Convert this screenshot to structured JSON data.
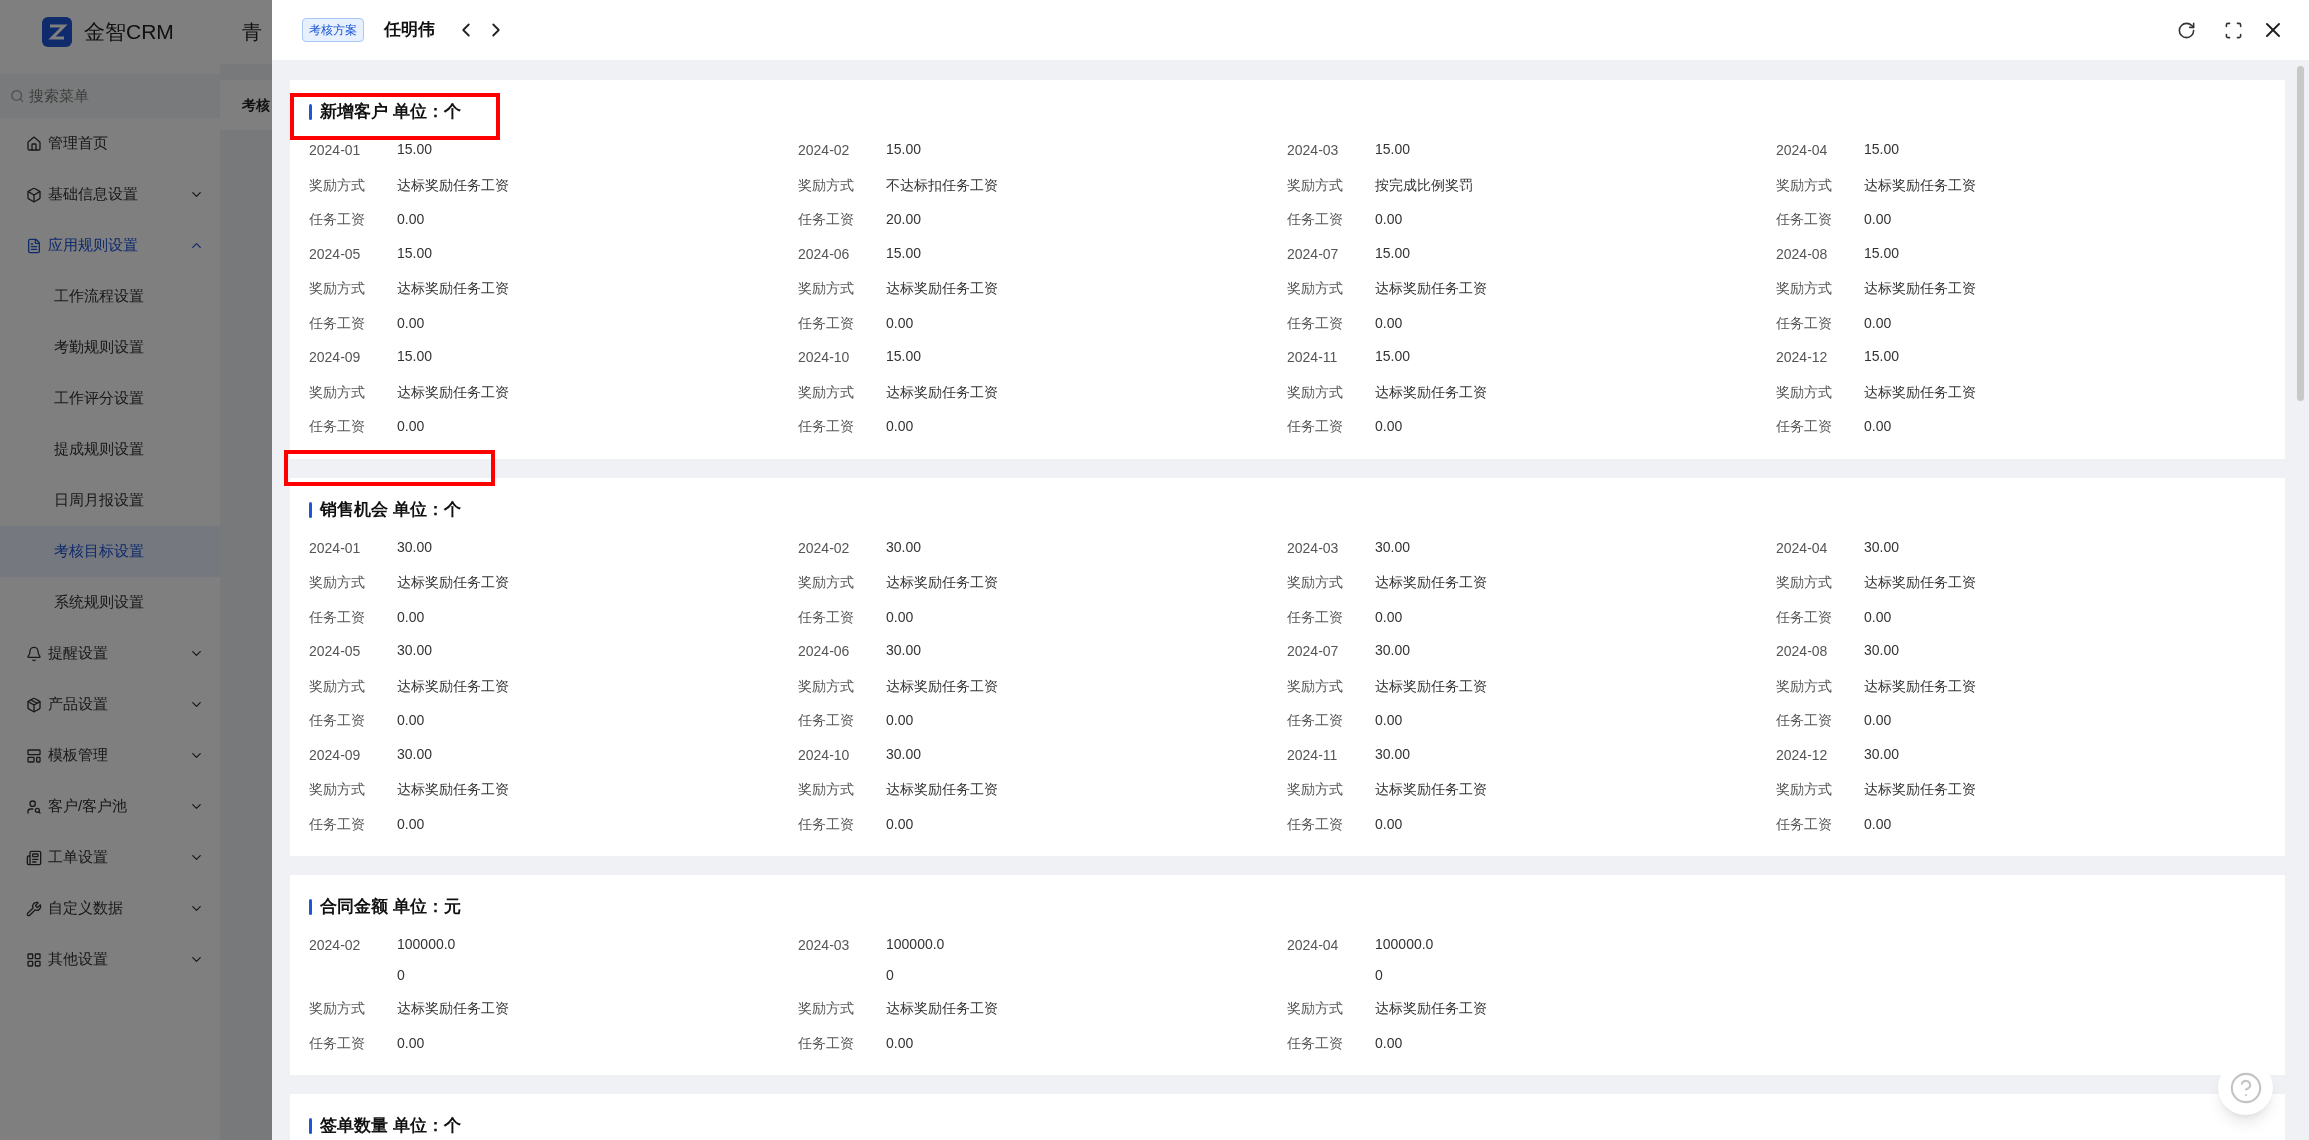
{
  "app": {
    "logo_text": "金智CRM",
    "header_fragment": "青",
    "page_title_fragment": "考核",
    "search": {
      "placeholder": "搜索菜单"
    }
  },
  "sidebar": {
    "items": [
      {
        "label": "管理首页",
        "kind": "link",
        "selected": false
      },
      {
        "label": "基础信息设置",
        "kind": "group",
        "expanded": false,
        "selected": false
      },
      {
        "label": "应用规则设置",
        "kind": "group",
        "expanded": true,
        "selected": true,
        "children": [
          {
            "label": "工作流程设置",
            "selected": false
          },
          {
            "label": "考勤规则设置",
            "selected": false
          },
          {
            "label": "工作评分设置",
            "selected": false
          },
          {
            "label": "提成规则设置",
            "selected": false
          },
          {
            "label": "日周月报设置",
            "selected": false
          },
          {
            "label": "考核目标设置",
            "selected": true
          },
          {
            "label": "系统规则设置",
            "selected": false
          }
        ]
      },
      {
        "label": "提醒设置",
        "kind": "group",
        "expanded": false,
        "selected": false
      },
      {
        "label": "产品设置",
        "kind": "group",
        "expanded": false,
        "selected": false
      },
      {
        "label": "模板管理",
        "kind": "group",
        "expanded": false,
        "selected": false
      },
      {
        "label": "客户/客户池",
        "kind": "group",
        "expanded": false,
        "selected": false
      },
      {
        "label": "工单设置",
        "kind": "group",
        "expanded": false,
        "selected": false
      },
      {
        "label": "自定义数据",
        "kind": "group",
        "expanded": false,
        "selected": false
      },
      {
        "label": "其他设置",
        "kind": "group",
        "expanded": false,
        "selected": false
      }
    ]
  },
  "drawer": {
    "tag": "考核方案",
    "person": "任明伟",
    "sections": [
      {
        "title": "新增客户 单位：个",
        "highlighted": true,
        "items": [
          {
            "month": "2024-01",
            "target": "15.00",
            "reward_label": "奖励方式",
            "reward": "达标奖励任务工资",
            "wage_label": "任务工资",
            "wage": "0.00"
          },
          {
            "month": "2024-02",
            "target": "15.00",
            "reward_label": "奖励方式",
            "reward": "不达标扣任务工资",
            "wage_label": "任务工资",
            "wage": "20.00"
          },
          {
            "month": "2024-03",
            "target": "15.00",
            "reward_label": "奖励方式",
            "reward": "按完成比例奖罚",
            "wage_label": "任务工资",
            "wage": "0.00"
          },
          {
            "month": "2024-04",
            "target": "15.00",
            "reward_label": "奖励方式",
            "reward": "达标奖励任务工资",
            "wage_label": "任务工资",
            "wage": "0.00"
          },
          {
            "month": "2024-05",
            "target": "15.00",
            "reward_label": "奖励方式",
            "reward": "达标奖励任务工资",
            "wage_label": "任务工资",
            "wage": "0.00"
          },
          {
            "month": "2024-06",
            "target": "15.00",
            "reward_label": "奖励方式",
            "reward": "达标奖励任务工资",
            "wage_label": "任务工资",
            "wage": "0.00"
          },
          {
            "month": "2024-07",
            "target": "15.00",
            "reward_label": "奖励方式",
            "reward": "达标奖励任务工资",
            "wage_label": "任务工资",
            "wage": "0.00"
          },
          {
            "month": "2024-08",
            "target": "15.00",
            "reward_label": "奖励方式",
            "reward": "达标奖励任务工资",
            "wage_label": "任务工资",
            "wage": "0.00"
          },
          {
            "month": "2024-09",
            "target": "15.00",
            "reward_label": "奖励方式",
            "reward": "达标奖励任务工资",
            "wage_label": "任务工资",
            "wage": "0.00"
          },
          {
            "month": "2024-10",
            "target": "15.00",
            "reward_label": "奖励方式",
            "reward": "达标奖励任务工资",
            "wage_label": "任务工资",
            "wage": "0.00"
          },
          {
            "month": "2024-11",
            "target": "15.00",
            "reward_label": "奖励方式",
            "reward": "达标奖励任务工资",
            "wage_label": "任务工资",
            "wage": "0.00"
          },
          {
            "month": "2024-12",
            "target": "15.00",
            "reward_label": "奖励方式",
            "reward": "达标奖励任务工资",
            "wage_label": "任务工资",
            "wage": "0.00"
          }
        ]
      },
      {
        "title": "销售机会 单位：个",
        "highlighted": false,
        "items": [
          {
            "month": "2024-01",
            "target": "30.00",
            "reward_label": "奖励方式",
            "reward": "达标奖励任务工资",
            "wage_label": "任务工资",
            "wage": "0.00"
          },
          {
            "month": "2024-02",
            "target": "30.00",
            "reward_label": "奖励方式",
            "reward": "达标奖励任务工资",
            "wage_label": "任务工资",
            "wage": "0.00"
          },
          {
            "month": "2024-03",
            "target": "30.00",
            "reward_label": "奖励方式",
            "reward": "达标奖励任务工资",
            "wage_label": "任务工资",
            "wage": "0.00"
          },
          {
            "month": "2024-04",
            "target": "30.00",
            "reward_label": "奖励方式",
            "reward": "达标奖励任务工资",
            "wage_label": "任务工资",
            "wage": "0.00"
          },
          {
            "month": "2024-05",
            "target": "30.00",
            "reward_label": "奖励方式",
            "reward": "达标奖励任务工资",
            "wage_label": "任务工资",
            "wage": "0.00"
          },
          {
            "month": "2024-06",
            "target": "30.00",
            "reward_label": "奖励方式",
            "reward": "达标奖励任务工资",
            "wage_label": "任务工资",
            "wage": "0.00"
          },
          {
            "month": "2024-07",
            "target": "30.00",
            "reward_label": "奖励方式",
            "reward": "达标奖励任务工资",
            "wage_label": "任务工资",
            "wage": "0.00"
          },
          {
            "month": "2024-08",
            "target": "30.00",
            "reward_label": "奖励方式",
            "reward": "达标奖励任务工资",
            "wage_label": "任务工资",
            "wage": "0.00"
          },
          {
            "month": "2024-09",
            "target": "30.00",
            "reward_label": "奖励方式",
            "reward": "达标奖励任务工资",
            "wage_label": "任务工资",
            "wage": "0.00"
          },
          {
            "month": "2024-10",
            "target": "30.00",
            "reward_label": "奖励方式",
            "reward": "达标奖励任务工资",
            "wage_label": "任务工资",
            "wage": "0.00"
          },
          {
            "month": "2024-11",
            "target": "30.00",
            "reward_label": "奖励方式",
            "reward": "达标奖励任务工资",
            "wage_label": "任务工资",
            "wage": "0.00"
          },
          {
            "month": "2024-12",
            "target": "30.00",
            "reward_label": "奖励方式",
            "reward": "达标奖励任务工资",
            "wage_label": "任务工资",
            "wage": "0.00"
          }
        ]
      },
      {
        "title": "合同金额 单位：元",
        "highlighted": false,
        "items": [
          {
            "month": "2024-02",
            "target": "100000.00",
            "reward_label": "奖励方式",
            "reward": "达标奖励任务工资",
            "wage_label": "任务工资",
            "wage": "0.00"
          },
          {
            "month": "2024-03",
            "target": "100000.00",
            "reward_label": "奖励方式",
            "reward": "达标奖励任务工资",
            "wage_label": "任务工资",
            "wage": "0.00"
          },
          {
            "month": "2024-04",
            "target": "100000.00",
            "reward_label": "奖励方式",
            "reward": "达标奖励任务工资",
            "wage_label": "任务工资",
            "wage": "0.00"
          }
        ]
      },
      {
        "title": "签单数量 单位：个",
        "highlighted": false
      }
    ]
  }
}
